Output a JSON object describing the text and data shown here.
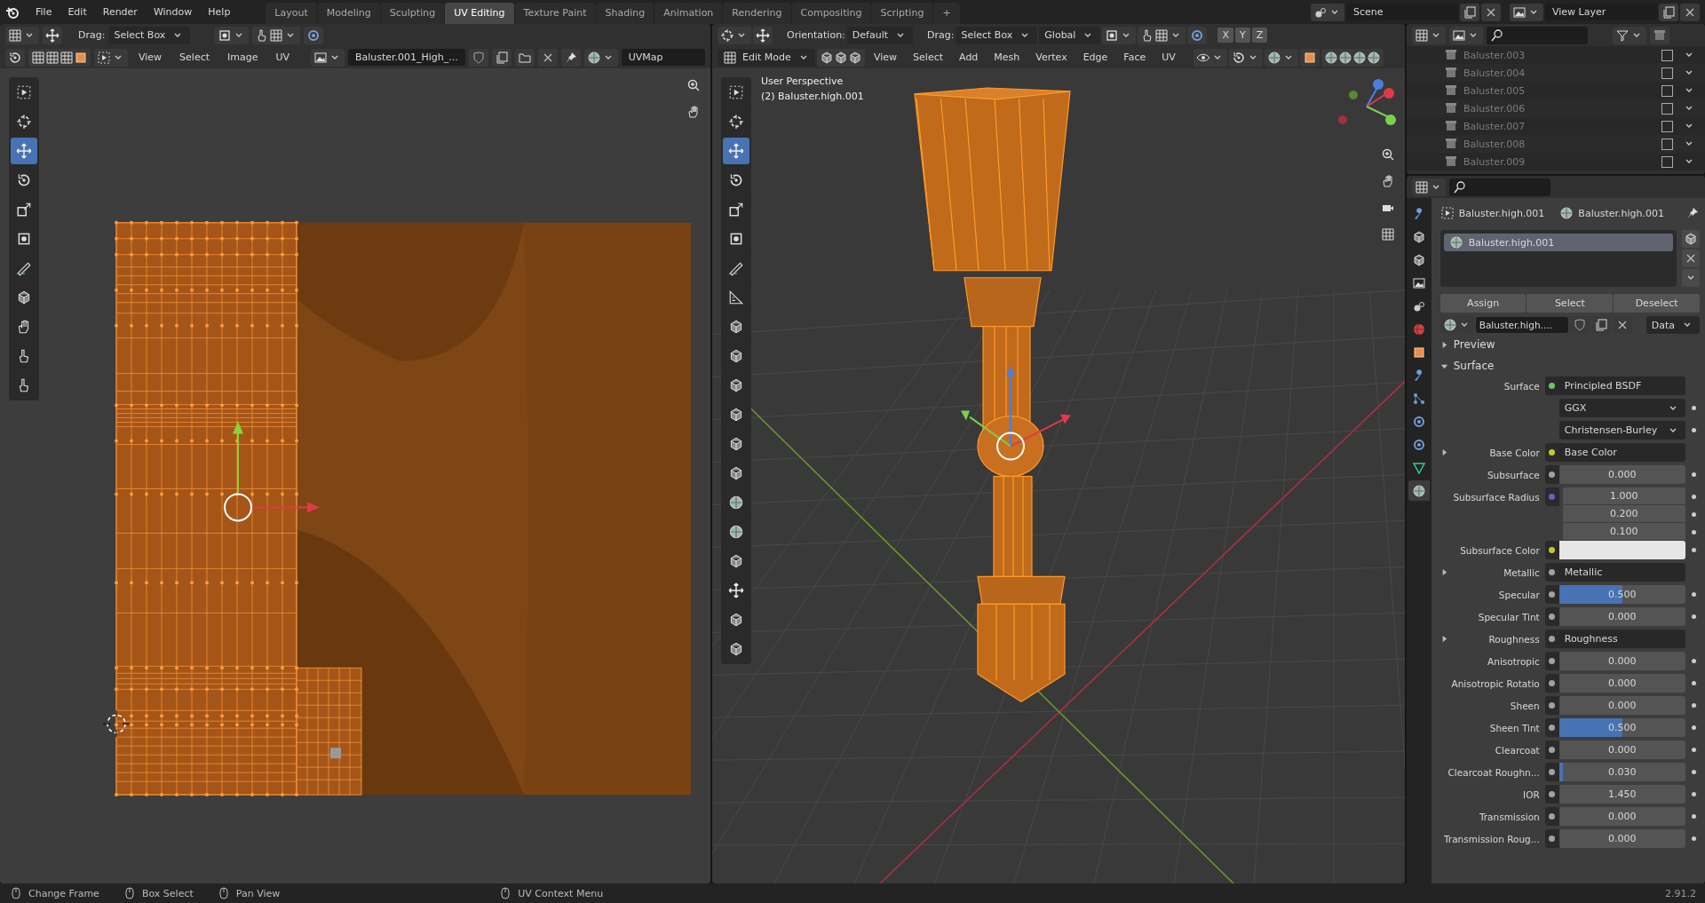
{
  "topbar": {
    "menus": [
      "File",
      "Edit",
      "Render",
      "Window",
      "Help"
    ],
    "workspaces": [
      {
        "label": "Layout",
        "selected": false
      },
      {
        "label": "Modeling",
        "selected": false
      },
      {
        "label": "Sculpting",
        "selected": false
      },
      {
        "label": "UV Editing",
        "selected": true
      },
      {
        "label": "Texture Paint",
        "selected": false
      },
      {
        "label": "Shading",
        "selected": false
      },
      {
        "label": "Animation",
        "selected": false
      },
      {
        "label": "Rendering",
        "selected": false
      },
      {
        "label": "Compositing",
        "selected": false
      },
      {
        "label": "Scripting",
        "selected": false
      }
    ],
    "add_tab": "+",
    "scene": "Scene",
    "view_layer": "View Layer"
  },
  "uv_editor": {
    "drag_label": "Drag:",
    "drag": "Select Box",
    "menus": [
      "View",
      "Select",
      "Image",
      "UV"
    ],
    "image": "Baluster.001_High_...",
    "uv_map": "UVMap",
    "tools": [
      {
        "selected": false
      },
      {
        "selected": false
      },
      {
        "selected": true
      },
      {
        "selected": false
      },
      {
        "selected": false
      },
      {
        "selected": false
      },
      {
        "selected": false
      },
      {
        "selected": false
      },
      {
        "selected": false
      },
      {
        "selected": false
      },
      {
        "selected": false
      }
    ]
  },
  "viewport": {
    "orientation_label": "Orientation:",
    "orientation": "Default",
    "drag_label": "Drag:",
    "drag": "Select Box",
    "transform": "Global",
    "mirror_axes": [
      "X",
      "Y",
      "Z"
    ],
    "mode": "Edit Mode",
    "menus": [
      "View",
      "Select",
      "Add",
      "Mesh",
      "Vertex",
      "Edge",
      "Face",
      "UV"
    ],
    "overlay_lines": [
      "User Perspective",
      "(2) Baluster.high.001"
    ],
    "tools": [
      {
        "selected": false
      },
      {
        "selected": false
      },
      {
        "selected": true
      },
      {
        "selected": false
      },
      {
        "selected": false
      },
      {
        "selected": false
      },
      {
        "selected": false
      },
      {
        "selected": false
      },
      {
        "selected": false
      },
      {
        "selected": false
      },
      {
        "selected": false
      },
      {
        "selected": false
      },
      {
        "selected": false
      },
      {
        "selected": false
      },
      {
        "selected": false
      },
      {
        "selected": false
      },
      {
        "selected": false
      },
      {
        "selected": false
      },
      {
        "selected": false
      },
      {
        "selected": false
      }
    ]
  },
  "outliner": {
    "items": [
      {
        "name": "Baluster.003",
        "checked": false
      },
      {
        "name": "Baluster.004",
        "checked": false
      },
      {
        "name": "Baluster.005",
        "checked": false
      },
      {
        "name": "Baluster.006",
        "checked": false
      },
      {
        "name": "Baluster.007",
        "checked": false
      },
      {
        "name": "Baluster.008",
        "checked": false
      },
      {
        "name": "Baluster.009",
        "checked": false
      }
    ]
  },
  "properties": {
    "object": "Baluster.high.001",
    "material": "Baluster.high.001",
    "slots": [
      {
        "name": "Baluster.high.001",
        "selected": true
      }
    ],
    "tabs": [
      {
        "selected": false
      },
      {
        "selected": false
      },
      {
        "selected": false
      },
      {
        "selected": false
      },
      {
        "selected": false
      },
      {
        "selected": false
      },
      {
        "selected": false
      },
      {
        "selected": false
      },
      {
        "selected": false
      },
      {
        "selected": false
      },
      {
        "selected": false
      },
      {
        "selected": false
      },
      {
        "selected": true
      }
    ],
    "slot_buttons": [
      "Assign",
      "Select",
      "Deselect"
    ],
    "material_field": "Baluster.high....",
    "link": "Data",
    "panels": [
      {
        "title": "Preview",
        "expanded": false
      },
      {
        "title": "Surface",
        "expanded": true
      }
    ],
    "rows": [
      {
        "kind": "shader",
        "label": "Surface",
        "color": "#63c763",
        "value": "Principled BSDF"
      },
      {
        "kind": "dropdown",
        "value": "GGX"
      },
      {
        "kind": "dropdown",
        "value": "Christensen-Burley"
      },
      {
        "kind": "link",
        "label": "Base Color",
        "color": "#c7c729",
        "value": "Base Color"
      },
      {
        "kind": "value",
        "label": "Subsurface",
        "color": "#a1a1a1",
        "value": "0.000",
        "level": 0
      },
      {
        "kind": "vector",
        "label": "Subsurface Radius",
        "color": "#6363c7",
        "values": [
          "1.000",
          "0.200",
          "0.100"
        ]
      },
      {
        "kind": "color",
        "label": "Subsurface Color",
        "color": "#c7c729"
      },
      {
        "kind": "link",
        "label": "Metallic",
        "color": "#a1a1a1",
        "value": "Metallic"
      },
      {
        "kind": "value",
        "label": "Specular",
        "color": "#a1a1a1",
        "value": "0.500",
        "level": 0.5
      },
      {
        "kind": "value",
        "label": "Specular Tint",
        "color": "#a1a1a1",
        "value": "0.000",
        "level": 0
      },
      {
        "kind": "link",
        "label": "Roughness",
        "color": "#a1a1a1",
        "value": "Roughness"
      },
      {
        "kind": "value",
        "label": "Anisotropic",
        "color": "#a1a1a1",
        "value": "0.000",
        "level": 0
      },
      {
        "kind": "value",
        "label": "Anisotropic Rotatio",
        "color": "#a1a1a1",
        "value": "0.000",
        "level": 0
      },
      {
        "kind": "value",
        "label": "Sheen",
        "color": "#a1a1a1",
        "value": "0.000",
        "level": 0
      },
      {
        "kind": "value",
        "label": "Sheen Tint",
        "color": "#a1a1a1",
        "value": "0.500",
        "level": 0.5
      },
      {
        "kind": "value",
        "label": "Clearcoat",
        "color": "#a1a1a1",
        "value": "0.000",
        "level": 0
      },
      {
        "kind": "value",
        "label": "Clearcoat Roughn...",
        "color": "#a1a1a1",
        "value": "0.030",
        "level": 0.03
      },
      {
        "kind": "value",
        "label": "IOR",
        "color": "#a1a1a1",
        "value": "1.450",
        "level": 0
      },
      {
        "kind": "value",
        "label": "Transmission",
        "color": "#a1a1a1",
        "value": "0.000",
        "level": 0
      },
      {
        "kind": "value",
        "label": "Transmission Roug...",
        "color": "#a1a1a1",
        "value": "0.000",
        "level": 0
      }
    ]
  },
  "status_bar": {
    "items": [
      "Change Frame",
      "Box Select",
      "Pan View",
      "UV Context Menu"
    ],
    "version": "2.91.2"
  }
}
